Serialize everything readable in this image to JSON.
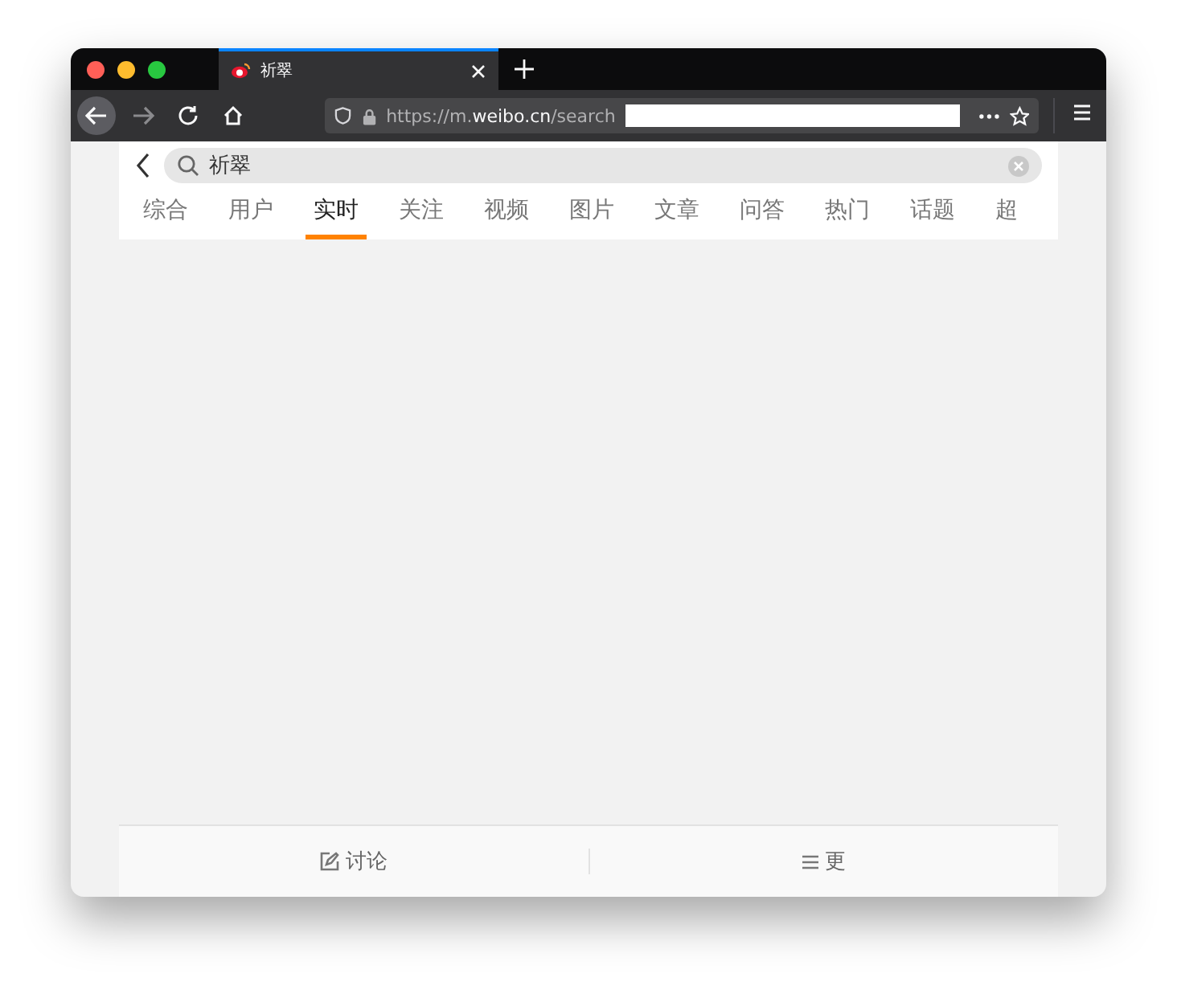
{
  "browser": {
    "tab": {
      "title": "祈翠"
    },
    "url": {
      "scheme": "https://",
      "host_pre": "m.",
      "host": "weibo.cn",
      "path": "/search"
    }
  },
  "search": {
    "value": "祈翠"
  },
  "tabs": [
    {
      "label": "综合",
      "selected": false
    },
    {
      "label": "用户",
      "selected": false
    },
    {
      "label": "实时",
      "selected": true
    },
    {
      "label": "关注",
      "selected": false
    },
    {
      "label": "视频",
      "selected": false
    },
    {
      "label": "图片",
      "selected": false
    },
    {
      "label": "文章",
      "selected": false
    },
    {
      "label": "问答",
      "selected": false
    },
    {
      "label": "热门",
      "selected": false
    },
    {
      "label": "话题",
      "selected": false
    },
    {
      "label": "超",
      "selected": false
    }
  ],
  "bottom_bar": [
    {
      "kind": "compose",
      "label": "讨论"
    },
    {
      "kind": "menu",
      "label": "更"
    }
  ]
}
